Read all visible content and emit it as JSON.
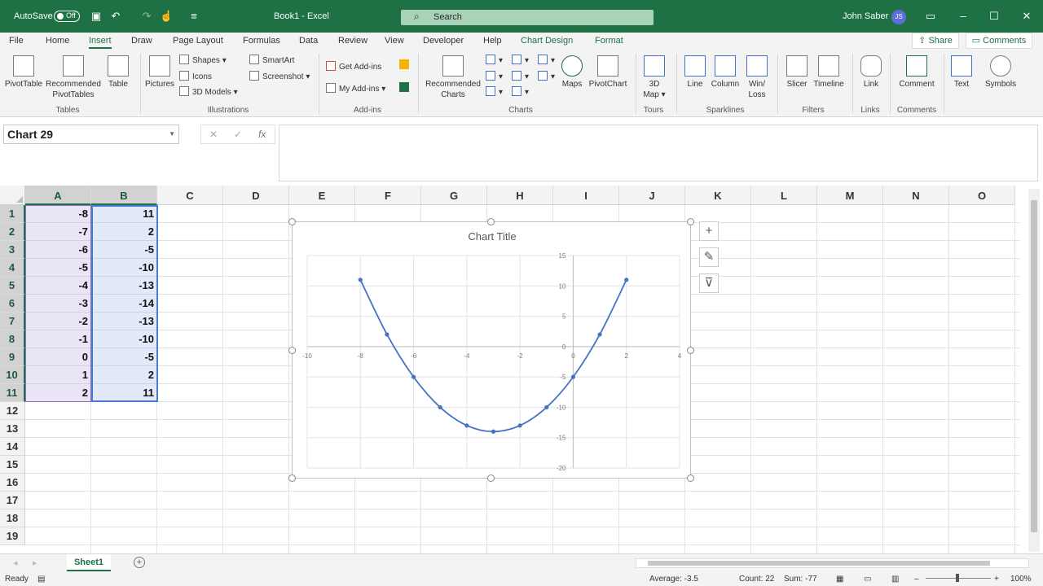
{
  "titlebar": {
    "autosave": "AutoSave",
    "autosave_state": "Off",
    "doc_title": "Book1 - Excel",
    "search_placeholder": "Search",
    "user_name": "John Saber",
    "user_initials": "JS"
  },
  "tabs": [
    "File",
    "Home",
    "Insert",
    "Draw",
    "Page Layout",
    "Formulas",
    "Data",
    "Review",
    "View",
    "Developer",
    "Help",
    "Chart Design",
    "Format"
  ],
  "active_tab": "Insert",
  "share_label": "Share",
  "comments_label": "Comments",
  "ribbon": {
    "pivottable": "PivotTable",
    "rec_pivot": [
      "Recommended",
      "PivotTables"
    ],
    "table": "Table",
    "pictures": "Pictures",
    "shapes": "Shapes",
    "icons": "Icons",
    "models": "3D Models",
    "smartart": "SmartArt",
    "screenshot": "Screenshot",
    "get_addins": "Get Add-ins",
    "my_addins": "My Add-ins",
    "rec_charts": [
      "Recommended",
      "Charts"
    ],
    "maps": "Maps",
    "pivotchart": "PivotChart",
    "map3d": [
      "3D",
      "Map"
    ],
    "line": "Line",
    "column": "Column",
    "winloss": [
      "Win/",
      "Loss"
    ],
    "slicer": "Slicer",
    "timeline": "Timeline",
    "link": "Link",
    "comment": "Comment",
    "text": "Text",
    "symbols": "Symbols",
    "groups": [
      "Tables",
      "Illustrations",
      "Add-ins",
      "Charts",
      "Tours",
      "Sparklines",
      "Filters",
      "Links",
      "Comments"
    ]
  },
  "namebox": "Chart 29",
  "fx": "fx",
  "columns": [
    "A",
    "B",
    "C",
    "D",
    "E",
    "F",
    "G",
    "H",
    "I",
    "J",
    "K",
    "L",
    "M",
    "N",
    "O"
  ],
  "rows": [
    "1",
    "2",
    "3",
    "4",
    "5",
    "6",
    "7",
    "8",
    "9",
    "10",
    "11",
    "12",
    "13",
    "14",
    "15",
    "16",
    "17",
    "18",
    "19"
  ],
  "cells_a": [
    "-8",
    "-7",
    "-6",
    "-5",
    "-4",
    "-3",
    "-2",
    "-1",
    "0",
    "1",
    "2"
  ],
  "cells_b": [
    "11",
    "2",
    "-5",
    "-10",
    "-13",
    "-14",
    "-13",
    "-10",
    "-5",
    "2",
    "11"
  ],
  "chart_data": {
    "type": "scatter",
    "title": "Chart Title",
    "x": [
      -8,
      -7,
      -6,
      -5,
      -4,
      -3,
      -2,
      -1,
      0,
      1,
      2
    ],
    "y": [
      11,
      2,
      -5,
      -10,
      -13,
      -14,
      -13,
      -10,
      -5,
      2,
      11
    ],
    "xlim": [
      -10,
      4
    ],
    "ylim": [
      -20,
      15
    ],
    "x_ticks": [
      -10,
      -8,
      -6,
      -4,
      -2,
      0,
      2,
      4
    ],
    "y_ticks": [
      15,
      10,
      5,
      0,
      -5,
      -10,
      -15,
      -20
    ],
    "series_color": "#4472c4",
    "smooth_line": true,
    "grid": true
  },
  "sheet_tab": "Sheet1",
  "status": {
    "ready": "Ready",
    "average": "Average: -3.5",
    "count": "Count: 22",
    "sum": "Sum: -77",
    "zoom": "100%"
  }
}
